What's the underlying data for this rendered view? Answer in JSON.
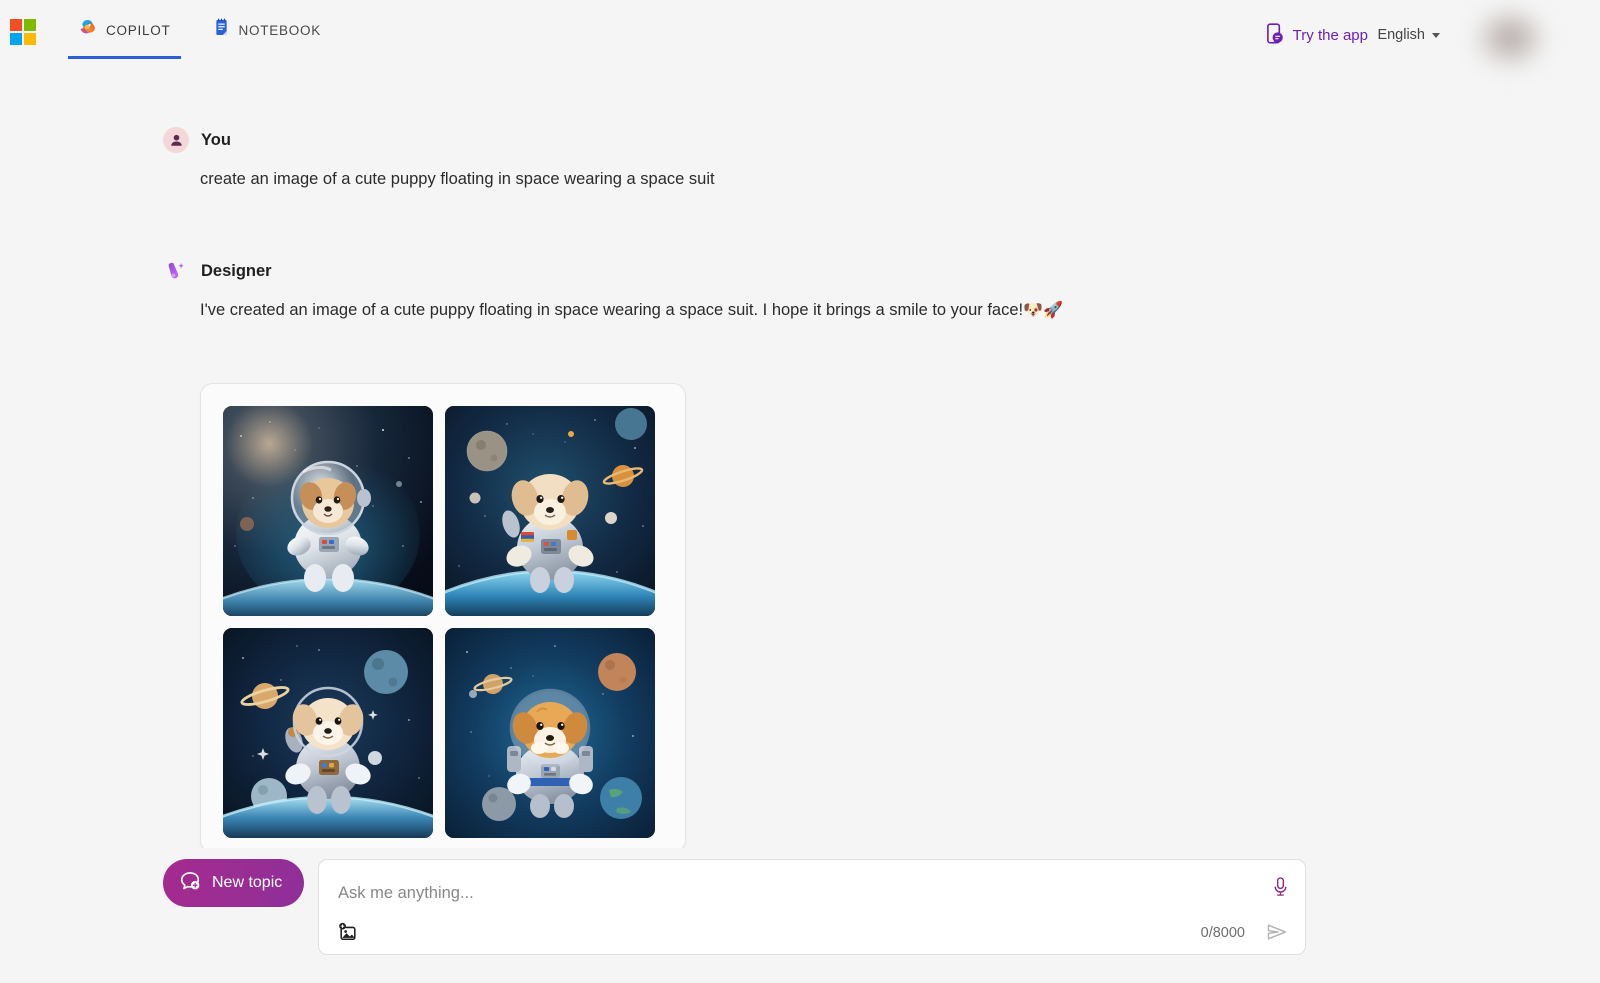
{
  "header": {
    "logo_name": "microsoft-logo",
    "logo_colors": [
      "#f25022",
      "#7fba00",
      "#00a4ef",
      "#ffb900"
    ],
    "tabs": [
      {
        "label": "COPILOT",
        "icon": "copilot-icon",
        "active": true
      },
      {
        "label": "NOTEBOOK",
        "icon": "notebook-icon",
        "active": false
      }
    ],
    "try_app": {
      "label": "Try the app",
      "icon": "mobile-app-icon",
      "color": "#6b21b5"
    },
    "language": {
      "label": "English",
      "icon": "chevron-down-icon"
    },
    "avatar": {
      "name": "user-avatar",
      "state": "blurred"
    },
    "active_tab_underline_color": "#2b5fd9"
  },
  "conversation": [
    {
      "role": "You",
      "avatar_icon": "person-icon",
      "text": "create an image of a cute puppy floating in space wearing a space suit"
    },
    {
      "role": "Designer",
      "avatar_icon": "designer-paintbrush-icon",
      "text": "I've created an image of a cute puppy floating in space wearing a space suit. I hope it brings a smile to your face!",
      "emoji": "🐶🚀"
    }
  ],
  "image_results": {
    "count": 4,
    "images": [
      {
        "alt": "puppy astronaut in white space suit over earth",
        "name": "generated-image-1"
      },
      {
        "alt": "puppy astronaut with silver suit and planets",
        "name": "generated-image-2"
      },
      {
        "alt": "puppy astronaut with saturn and moons",
        "name": "generated-image-3"
      },
      {
        "alt": "puppy astronaut in blue trimmed suit",
        "name": "generated-image-4"
      }
    ]
  },
  "composer": {
    "new_topic_label": "New topic",
    "new_topic_icon": "chat-plus-icon",
    "new_topic_color": "#9c2d92",
    "input_placeholder": "Ask me anything...",
    "input_value": "",
    "add_image_icon": "add-image-icon",
    "mic_icon": "microphone-icon",
    "mic_color": "#8f2f7a",
    "char_count": "0/8000",
    "send_icon": "send-icon"
  }
}
